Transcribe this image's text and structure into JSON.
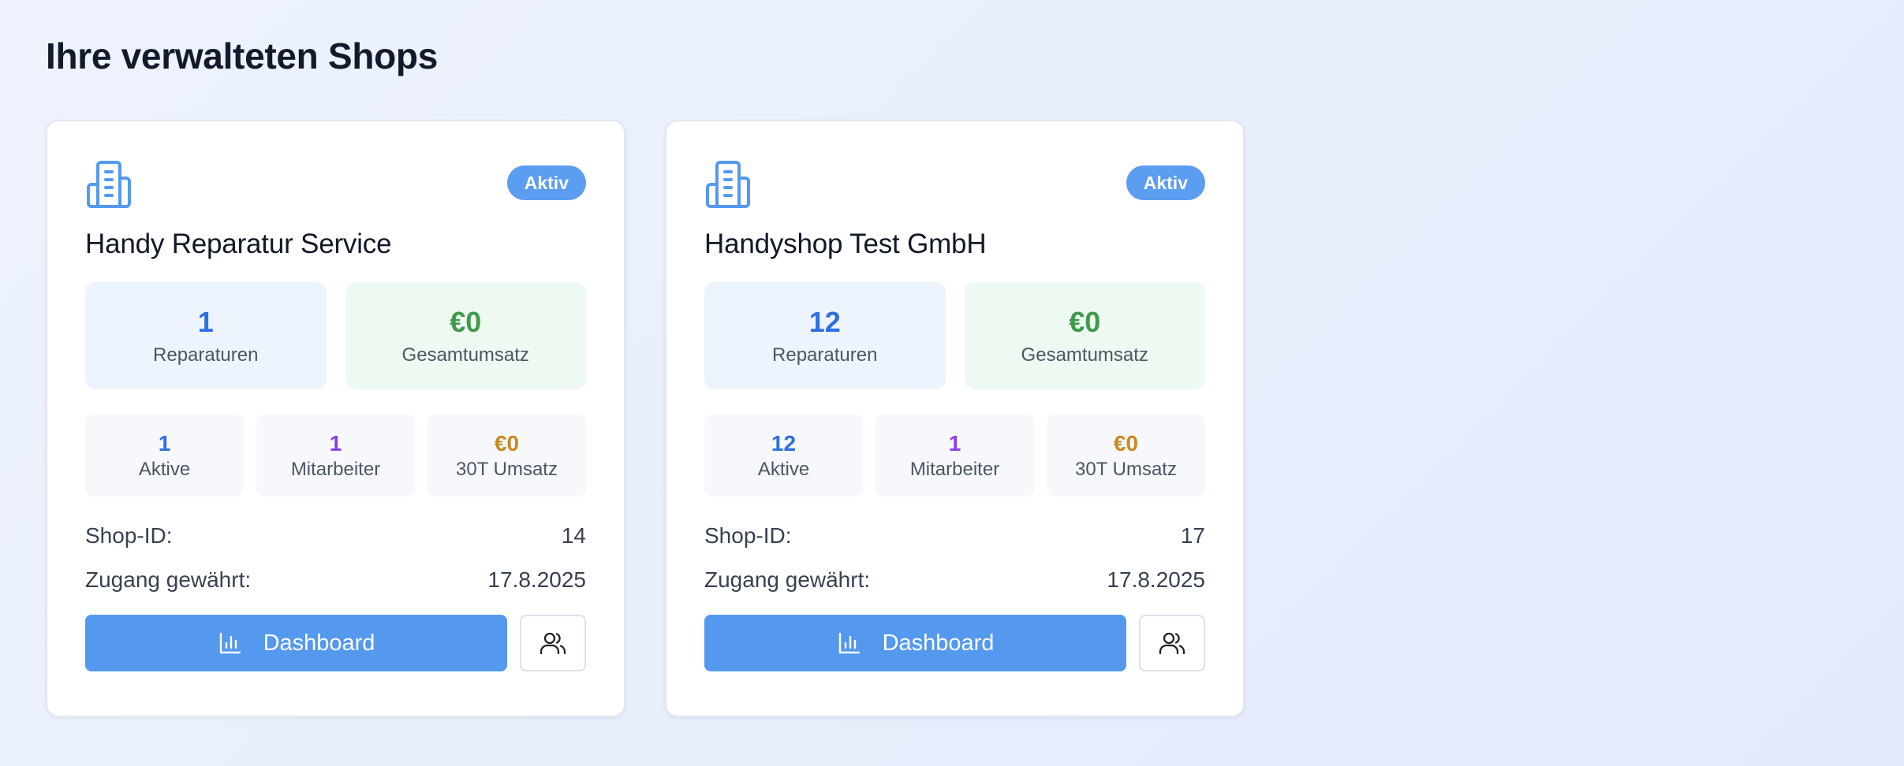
{
  "page": {
    "title": "Ihre verwalteten Shops"
  },
  "colors": {
    "accent": "#5599ee",
    "badge": "#5b9df0",
    "repairs": "#2f6fe0",
    "revenue": "#3f9a4c",
    "staff": "#8b3fe6",
    "revenue30": "#c98a22"
  },
  "shops": [
    {
      "icon": "building-icon",
      "status": "Aktiv",
      "name": "Handy Reparatur Service",
      "repairs_value": "1",
      "repairs_label": "Reparaturen",
      "revenue_value": "€0",
      "revenue_label": "Gesamtumsatz",
      "active_value": "1",
      "active_label": "Aktive",
      "staff_value": "1",
      "staff_label": "Mitarbeiter",
      "revenue30_value": "€0",
      "revenue30_label": "30T Umsatz",
      "shop_id_label": "Shop-ID:",
      "shop_id": "14",
      "access_label": "Zugang gewährt:",
      "access_date": "17.8.2025",
      "dashboard_label": "Dashboard",
      "dashboard_icon": "bar-chart-icon",
      "users_icon": "users-icon"
    },
    {
      "icon": "building-icon",
      "status": "Aktiv",
      "name": "Handyshop Test GmbH",
      "repairs_value": "12",
      "repairs_label": "Reparaturen",
      "revenue_value": "€0",
      "revenue_label": "Gesamtumsatz",
      "active_value": "12",
      "active_label": "Aktive",
      "staff_value": "1",
      "staff_label": "Mitarbeiter",
      "revenue30_value": "€0",
      "revenue30_label": "30T Umsatz",
      "shop_id_label": "Shop-ID:",
      "shop_id": "17",
      "access_label": "Zugang gewährt:",
      "access_date": "17.8.2025",
      "dashboard_label": "Dashboard",
      "dashboard_icon": "bar-chart-icon",
      "users_icon": "users-icon"
    }
  ]
}
